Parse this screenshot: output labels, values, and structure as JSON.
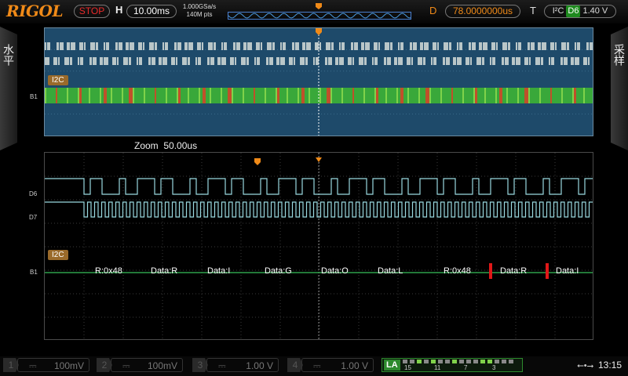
{
  "brand": "RIGOL",
  "top_bar": {
    "run_status": "STOP",
    "horizontal_label": "H",
    "timebase": "10.00ms",
    "sample_rate": "1.000GSa/s",
    "memory_depth": "140M pts",
    "delay_label": "D",
    "delay_value": "78.0000000us",
    "trigger_label": "T",
    "trigger_type": "I²C",
    "trigger_channel": "D6",
    "trigger_level": "1.40 V"
  },
  "side_tabs": {
    "left": "水平",
    "right": "采样"
  },
  "main_window": {
    "bus_tag": "I2C",
    "bus_marker": "B1"
  },
  "zoom_window": {
    "label": "Zoom",
    "scale": "50.00us",
    "channel_markers": [
      "D6",
      "D7"
    ],
    "bus_tag": "I2C",
    "bus_marker": "B1"
  },
  "decode_packets": [
    {
      "text": "R:0x48",
      "kind": "address"
    },
    {
      "text": "Data:R",
      "kind": "data"
    },
    {
      "text": "Data:I",
      "kind": "data"
    },
    {
      "text": "Data:G",
      "kind": "data"
    },
    {
      "text": "Data:O",
      "kind": "data"
    },
    {
      "text": "Data:L",
      "kind": "data"
    },
    {
      "text": "R:0x48",
      "kind": "address"
    },
    {
      "text": "Data:R",
      "kind": "data"
    },
    {
      "text": "Data:I",
      "kind": "data"
    }
  ],
  "bottom_bar": {
    "channels": [
      {
        "num": "1",
        "scale": "100mV"
      },
      {
        "num": "2",
        "scale": "100mV"
      },
      {
        "num": "3",
        "scale": "1.00 V"
      },
      {
        "num": "4",
        "scale": "1.00 V"
      }
    ],
    "la_label": "LA",
    "la_numbers": [
      "15",
      "11",
      "7",
      "3"
    ],
    "time": "13:15"
  },
  "colors": {
    "brand": "#f08a18",
    "stop": "#e82a2a",
    "digital_trace": "#9ad9e0",
    "address_packet": "#1f4fb0",
    "data_packet": "#177a3f",
    "error_marker": "#e01818",
    "main_bg": "#1e4a6a"
  }
}
